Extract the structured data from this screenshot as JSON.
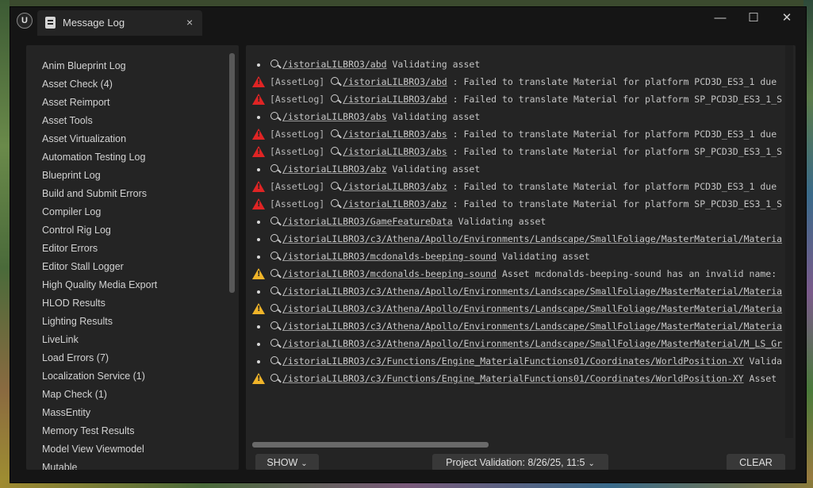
{
  "window": {
    "tab_title": "Message Log",
    "close_tab_glyph": "×",
    "minimize_glyph": "—",
    "maximize_glyph": "☐",
    "close_glyph": "✕",
    "logo_glyph": "U"
  },
  "sidebar": {
    "items": [
      {
        "label": "Anim Blueprint Log"
      },
      {
        "label": "Asset Check (4)"
      },
      {
        "label": "Asset Reimport"
      },
      {
        "label": "Asset Tools"
      },
      {
        "label": "Asset Virtualization"
      },
      {
        "label": "Automation Testing Log"
      },
      {
        "label": "Blueprint Log"
      },
      {
        "label": "Build and Submit Errors"
      },
      {
        "label": "Compiler Log"
      },
      {
        "label": "Control Rig Log"
      },
      {
        "label": "Editor Errors"
      },
      {
        "label": "Editor Stall Logger"
      },
      {
        "label": "High Quality Media Export"
      },
      {
        "label": "HLOD Results"
      },
      {
        "label": "Lighting Results"
      },
      {
        "label": "LiveLink"
      },
      {
        "label": "Load Errors (7)"
      },
      {
        "label": "Localization Service (1)"
      },
      {
        "label": "Map Check (1)"
      },
      {
        "label": "MassEntity"
      },
      {
        "label": "Memory Test Results"
      },
      {
        "label": "Model View Viewmodel"
      },
      {
        "label": "Mutable"
      }
    ]
  },
  "log": {
    "rows": [
      {
        "severity": "info",
        "tag": "",
        "link": "/istoriaLILBRO3/abd",
        "text": " Validating asset"
      },
      {
        "severity": "error",
        "tag": "[AssetLog] ",
        "link": "/istoriaLILBRO3/abd",
        "text": " : Failed to translate Material for platform PCD3D_ES3_1 due"
      },
      {
        "severity": "error",
        "tag": "[AssetLog] ",
        "link": "/istoriaLILBRO3/abd",
        "text": " : Failed to translate Material for platform SP_PCD3D_ES3_1_S"
      },
      {
        "severity": "info",
        "tag": "",
        "link": "/istoriaLILBRO3/abs",
        "text": " Validating asset"
      },
      {
        "severity": "error",
        "tag": "[AssetLog] ",
        "link": "/istoriaLILBRO3/abs",
        "text": " : Failed to translate Material for platform PCD3D_ES3_1 due"
      },
      {
        "severity": "error",
        "tag": "[AssetLog] ",
        "link": "/istoriaLILBRO3/abs",
        "text": " : Failed to translate Material for platform SP_PCD3D_ES3_1_S"
      },
      {
        "severity": "info",
        "tag": "",
        "link": "/istoriaLILBRO3/abz",
        "text": " Validating asset"
      },
      {
        "severity": "error",
        "tag": "[AssetLog] ",
        "link": "/istoriaLILBRO3/abz",
        "text": " : Failed to translate Material for platform PCD3D_ES3_1 due"
      },
      {
        "severity": "error",
        "tag": "[AssetLog] ",
        "link": "/istoriaLILBRO3/abz",
        "text": " : Failed to translate Material for platform SP_PCD3D_ES3_1_S"
      },
      {
        "severity": "info",
        "tag": "",
        "link": "/istoriaLILBRO3/GameFeatureData",
        "text": " Validating asset"
      },
      {
        "severity": "info",
        "tag": "",
        "link": "/istoriaLILBRO3/c3/Athena/Apollo/Environments/Landscape/SmallFoliage/MasterMaterial/Materia",
        "text": ""
      },
      {
        "severity": "info",
        "tag": "",
        "link": "/istoriaLILBRO3/mcdonalds-beeping-sound",
        "text": " Validating asset"
      },
      {
        "severity": "warning",
        "tag": "",
        "link": "/istoriaLILBRO3/mcdonalds-beeping-sound",
        "text": " Asset mcdonalds-beeping-sound has an invalid name:"
      },
      {
        "severity": "info",
        "tag": "",
        "link": "/istoriaLILBRO3/c3/Athena/Apollo/Environments/Landscape/SmallFoliage/MasterMaterial/Materia",
        "text": ""
      },
      {
        "severity": "warning",
        "tag": "",
        "link": "/istoriaLILBRO3/c3/Athena/Apollo/Environments/Landscape/SmallFoliage/MasterMaterial/Materia",
        "text": ""
      },
      {
        "severity": "info",
        "tag": "",
        "link": "/istoriaLILBRO3/c3/Athena/Apollo/Environments/Landscape/SmallFoliage/MasterMaterial/Materia",
        "text": ""
      },
      {
        "severity": "info",
        "tag": "",
        "link": "/istoriaLILBRO3/c3/Athena/Apollo/Environments/Landscape/SmallFoliage/MasterMaterial/M_LS_Gr",
        "text": ""
      },
      {
        "severity": "info",
        "tag": "",
        "link": "/istoriaLILBRO3/c3/Functions/Engine_MaterialFunctions01/Coordinates/WorldPosition-XY",
        "text": " Valida"
      },
      {
        "severity": "warning",
        "tag": "",
        "link": "/istoriaLILBRO3/c3/Functions/Engine_MaterialFunctions01/Coordinates/WorldPosition-XY",
        "text": " Asset"
      }
    ]
  },
  "footer": {
    "show_label": "SHOW",
    "session_label": "Project Validation: 8/26/25, 11:5",
    "clear_label": "CLEAR",
    "chevron_glyph": "⌄"
  },
  "colors": {
    "error": "#e02424",
    "warning": "#f0b429",
    "panel": "#242424",
    "window": "#151515"
  }
}
